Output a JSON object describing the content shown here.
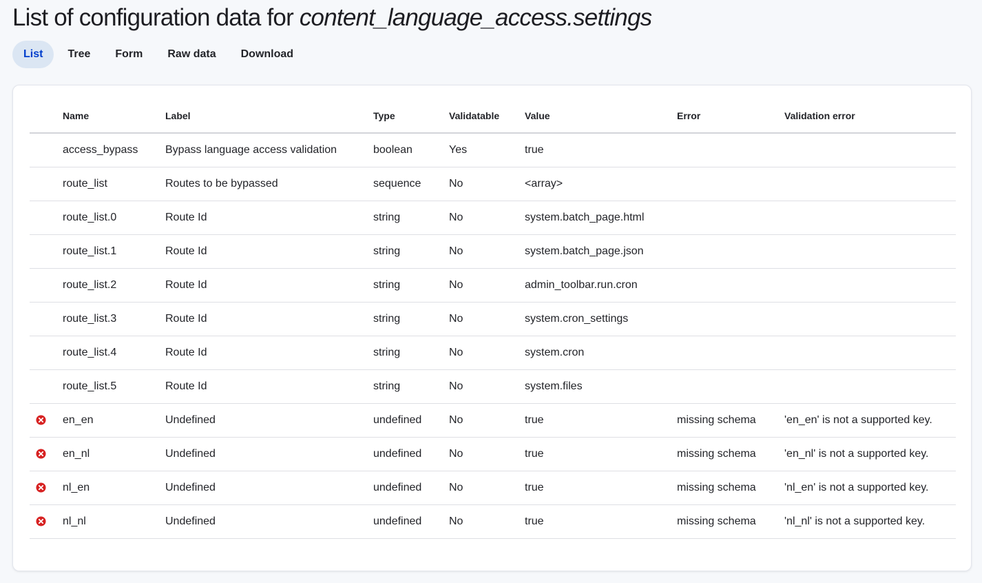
{
  "page": {
    "title_prefix": "List of configuration data for ",
    "title_config": "content_language_access.settings"
  },
  "tabs": [
    {
      "label": "List",
      "active": true
    },
    {
      "label": "Tree",
      "active": false
    },
    {
      "label": "Form",
      "active": false
    },
    {
      "label": "Raw data",
      "active": false
    },
    {
      "label": "Download",
      "active": false
    }
  ],
  "table": {
    "headers": [
      "Name",
      "Label",
      "Type",
      "Validatable",
      "Value",
      "Error",
      "Validation error"
    ],
    "rows": [
      {
        "error_icon": false,
        "name": "access_bypass",
        "label": "Bypass language access validation",
        "type": "boolean",
        "validatable": "Yes",
        "value": "true",
        "error": "",
        "validation_error": ""
      },
      {
        "error_icon": false,
        "name": "route_list",
        "label": "Routes to be bypassed",
        "type": "sequence",
        "validatable": "No",
        "value": "<array>",
        "error": "",
        "validation_error": ""
      },
      {
        "error_icon": false,
        "name": "route_list.0",
        "label": "Route Id",
        "type": "string",
        "validatable": "No",
        "value": "system.batch_page.html",
        "error": "",
        "validation_error": ""
      },
      {
        "error_icon": false,
        "name": "route_list.1",
        "label": "Route Id",
        "type": "string",
        "validatable": "No",
        "value": "system.batch_page.json",
        "error": "",
        "validation_error": ""
      },
      {
        "error_icon": false,
        "name": "route_list.2",
        "label": "Route Id",
        "type": "string",
        "validatable": "No",
        "value": "admin_toolbar.run.cron",
        "error": "",
        "validation_error": ""
      },
      {
        "error_icon": false,
        "name": "route_list.3",
        "label": "Route Id",
        "type": "string",
        "validatable": "No",
        "value": "system.cron_settings",
        "error": "",
        "validation_error": ""
      },
      {
        "error_icon": false,
        "name": "route_list.4",
        "label": "Route Id",
        "type": "string",
        "validatable": "No",
        "value": "system.cron",
        "error": "",
        "validation_error": ""
      },
      {
        "error_icon": false,
        "name": "route_list.5",
        "label": "Route Id",
        "type": "string",
        "validatable": "No",
        "value": "system.files",
        "error": "",
        "validation_error": ""
      },
      {
        "error_icon": true,
        "name": "en_en",
        "label": "Undefined",
        "type": "undefined",
        "validatable": "No",
        "value": "true",
        "error": "missing schema",
        "validation_error": "'en_en' is not a supported key."
      },
      {
        "error_icon": true,
        "name": "en_nl",
        "label": "Undefined",
        "type": "undefined",
        "validatable": "No",
        "value": "true",
        "error": "missing schema",
        "validation_error": "'en_nl' is not a supported key."
      },
      {
        "error_icon": true,
        "name": "nl_en",
        "label": "Undefined",
        "type": "undefined",
        "validatable": "No",
        "value": "true",
        "error": "missing schema",
        "validation_error": "'nl_en' is not a supported key."
      },
      {
        "error_icon": true,
        "name": "nl_nl",
        "label": "Undefined",
        "type": "undefined",
        "validatable": "No",
        "value": "true",
        "error": "missing schema",
        "validation_error": "'nl_nl' is not a supported key."
      }
    ]
  },
  "colors": {
    "error_icon": "#d72222",
    "active_tab_bg": "#dbe6f3",
    "active_tab_text": "#003ecc"
  },
  "icons": {
    "error": "error-circle-x-icon"
  }
}
